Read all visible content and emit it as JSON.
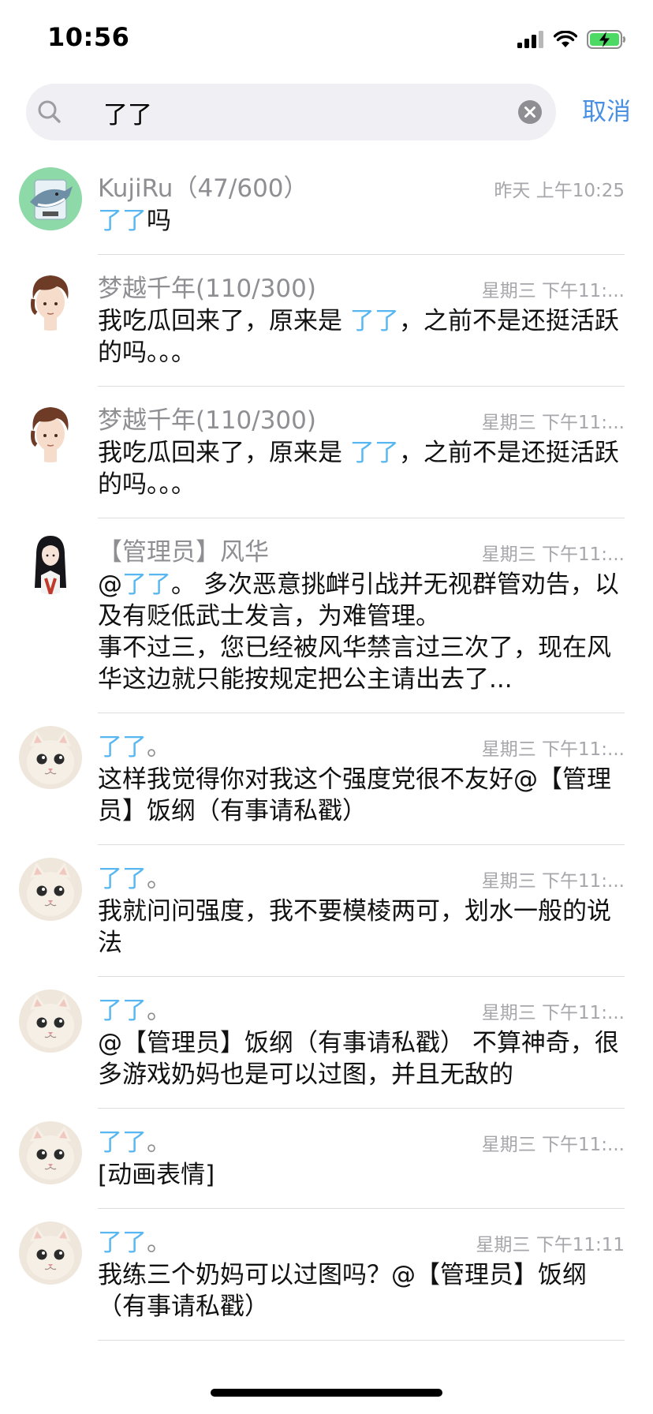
{
  "status_bar": {
    "time": "10:56"
  },
  "search": {
    "query": "了了",
    "cancel_label": "取消"
  },
  "results": [
    {
      "sender_name": "KujiRu（47/600）",
      "time": "昨天 上午10:25",
      "msg_hl": "了了",
      "msg_rest": "吗",
      "avatar": "shark-avatar"
    },
    {
      "sender_name": "梦越千年(110/300)",
      "time": "星期三 下午11:...",
      "msg_pre": "我吃瓜回来了，原来是 ",
      "msg_hl": "了了",
      "msg_rest": "，之前不是还挺活跃的吗。。。",
      "avatar": "boy-avatar"
    },
    {
      "sender_name": "梦越千年(110/300)",
      "time": "星期三 下午11:...",
      "msg_pre": "我吃瓜回来了，原来是 ",
      "msg_hl": "了了",
      "msg_rest": "，之前不是还挺活跃的吗。。。",
      "avatar": "boy-avatar"
    },
    {
      "sender_name": "【管理员】风华",
      "time": "星期三 下午11:...",
      "msg_pre": "@",
      "msg_hl": "了了",
      "msg_rest": "。 多次恶意挑衅引战并无视群管劝告，以及有贬低武士发言，为难管理。\n事不过三，您已经被风华禁言过三次了，现在风华这边就只能按规定把公主请出去了...",
      "avatar": "girl-avatar"
    },
    {
      "sender_hl": "了了",
      "sender_suffix": "。",
      "time": "星期三 下午11:...",
      "msg_rest": "这样我觉得你对我这个强度党很不友好@【管理员】饭纲（有事请私戳）",
      "avatar": "cat-avatar"
    },
    {
      "sender_hl": "了了",
      "sender_suffix": "。",
      "time": "星期三 下午11:...",
      "msg_rest": "我就问问强度，我不要模棱两可，划水一般的说法",
      "avatar": "cat-avatar"
    },
    {
      "sender_hl": "了了",
      "sender_suffix": "。",
      "time": "星期三 下午11:...",
      "msg_rest": "@【管理员】饭纲（有事请私戳） 不算神奇，很多游戏奶妈也是可以过图，并且无敌的",
      "avatar": "cat-avatar"
    },
    {
      "sender_hl": "了了",
      "sender_suffix": "。",
      "time": "星期三 下午11:...",
      "msg_rest": "[动画表情]",
      "avatar": "cat-avatar"
    },
    {
      "sender_hl": "了了",
      "sender_suffix": "。",
      "time": "星期三 下午11:11",
      "msg_rest": "我练三个奶妈可以过图吗？@【管理员】饭纲（有事请私戳）",
      "avatar": "cat-avatar"
    }
  ],
  "colors": {
    "highlight": "#58b7f0",
    "accent": "#4a90e2",
    "muted": "#8e8e93"
  }
}
